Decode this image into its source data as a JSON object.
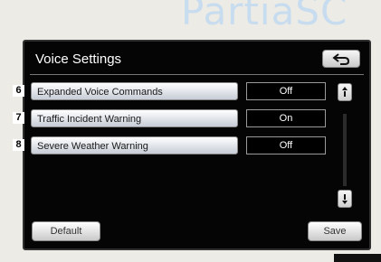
{
  "watermark": "PartiaSC",
  "screen": {
    "title": "Voice Settings",
    "back_icon": "back-arrow-icon",
    "rows": [
      {
        "index": "6",
        "label": "Expanded Voice Commands",
        "value": "Off"
      },
      {
        "index": "7",
        "label": "Traffic Incident Warning",
        "value": "On"
      },
      {
        "index": "8",
        "label": "Severe Weather Warning",
        "value": "Off"
      }
    ],
    "default_label": "Default",
    "save_label": "Save"
  },
  "colors": {
    "screen_bg": "#050505",
    "button_top": "#ffffff",
    "button_bottom": "#c6ccd6",
    "watermark": "#c7dcef"
  }
}
